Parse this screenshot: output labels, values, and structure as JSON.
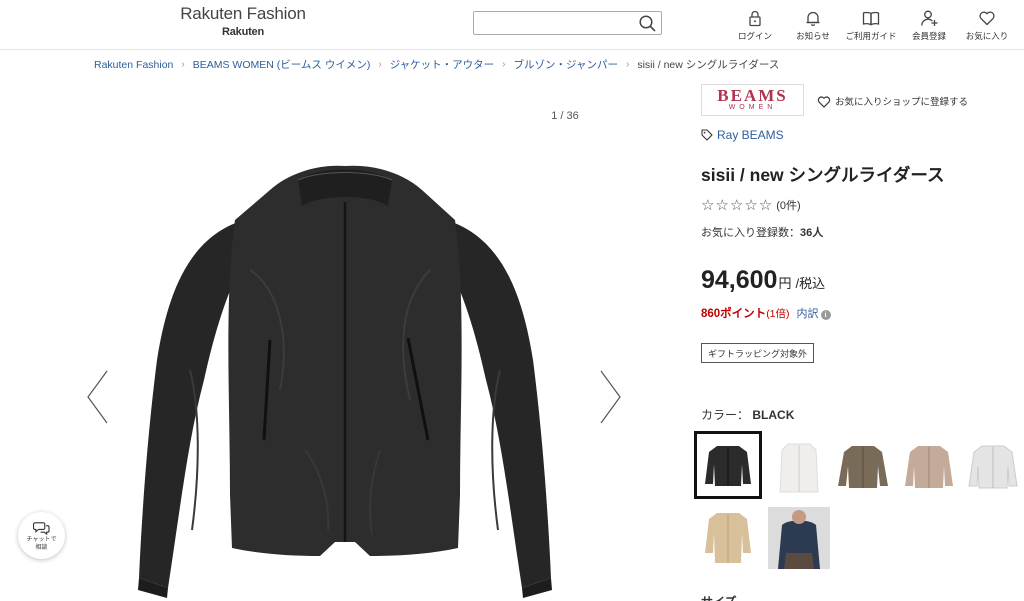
{
  "header": {
    "logo_main": "Rakuten Fashion",
    "logo_sub": "Rakuten",
    "search_placeholder": "",
    "nav": [
      {
        "label": "ログイン",
        "icon": "lock-icon"
      },
      {
        "label": "お知らせ",
        "icon": "bell-icon"
      },
      {
        "label": "ご利用ガイド",
        "icon": "book-icon"
      },
      {
        "label": "会員登録",
        "icon": "add-user-icon"
      },
      {
        "label": "お気に入り",
        "icon": "heart-icon"
      }
    ]
  },
  "breadcrumb": {
    "items": [
      "Rakuten Fashion",
      "BEAMS WOMEN (ビームス ウイメン)",
      "ジャケット・アウター",
      "ブルゾン・ジャンパー"
    ],
    "current": "sisii / new シングルライダース"
  },
  "gallery": {
    "counter": "1 / 36"
  },
  "chat": {
    "line1": "チャットで",
    "line2": "相談"
  },
  "shop": {
    "logo_main": "BEAMS",
    "logo_sub": "WOMEN",
    "fav_label": "お気に入りショップに登録する"
  },
  "product": {
    "brand": "Ray BEAMS",
    "title": "sisii / new シングルライダース",
    "stars": "☆☆☆☆☆",
    "rating_value": 0,
    "review_count": "(0件)",
    "fav_count_label": "お気に入り登録数：",
    "fav_count_value": "36人",
    "price": "94,600",
    "price_unit": "円",
    "price_tax": "/税込",
    "points": "860ポイント",
    "points_multiplier": "(1倍)",
    "points_detail": "内訳",
    "info_icon": "i",
    "gift_badge": "ギフトラッピング対象外",
    "color_label": "カラー：",
    "color_value": "BLACK",
    "size_label": "サイズ"
  },
  "colors": {
    "link": "#2e5d9a",
    "point": "#bf0000",
    "shop_logo": "#b0334f",
    "swatches": [
      "#2b2b2b",
      "#f0eeea",
      "#7a6a58",
      "#c4aa98",
      "#e4e4e4",
      "#d8c09a",
      "#2c3a52"
    ]
  }
}
